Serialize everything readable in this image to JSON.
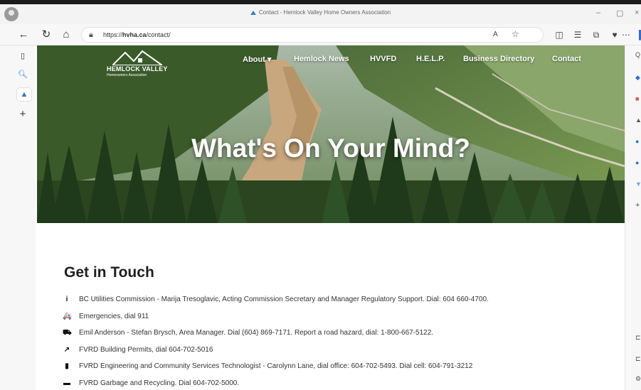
{
  "window": {
    "tab_title": "Contact - Hemlock Valley Home Owners Association",
    "minimize": "–",
    "maximize": "▢",
    "close": "×"
  },
  "addressbar": {
    "url_prefix": "https://",
    "url_host": "hvha.ca",
    "url_path": "/contact/",
    "read_aloud": "A̩"
  },
  "site": {
    "logo_name": "HEMLOCK VALLEY",
    "logo_sub": "Homeowners Association",
    "nav": [
      "About ▾",
      "Hemlock News",
      "HVVFD",
      "H.E.L.P.",
      "Business Directory",
      "Contact"
    ],
    "hero_title": "What's On Your Mind?",
    "section_title": "Get in Touch",
    "contacts": [
      {
        "icon": "info-icon",
        "glyph": "i",
        "text": "BC Utilities Commission - Marija Tresoglavic, Acting Commission Secretary and Manager Regulatory Support. Dial: 604 660-4700."
      },
      {
        "icon": "ambulance-icon",
        "glyph": "🚑",
        "text": "Emergencies, dial 911"
      },
      {
        "icon": "road-icon",
        "glyph": "⛟",
        "text": "Emil Anderson - Stefan Brysch, Area Manager. Dial (604) 869-7171. Report a road hazard, dial: 1-800-667-5122."
      },
      {
        "icon": "hammer-icon",
        "glyph": "↗",
        "text": "FVRD Building Permits, dial 604-702-5016"
      },
      {
        "icon": "clipboard-icon",
        "glyph": "▮",
        "text": "FVRD Engineering and Community Services Technologist - Carolynn Lane, dial office: 604-702-5493. Dial cell: 604-791-3212"
      },
      {
        "icon": "trash-icon",
        "glyph": "▬",
        "text": "FVRD Garbage and Recycling. Dial 604-702-5000."
      }
    ]
  },
  "colors": {
    "hero_sky": "#c9d6c3",
    "forest": "#2d4a22",
    "road": "#c9a77e",
    "text": "#333333"
  }
}
